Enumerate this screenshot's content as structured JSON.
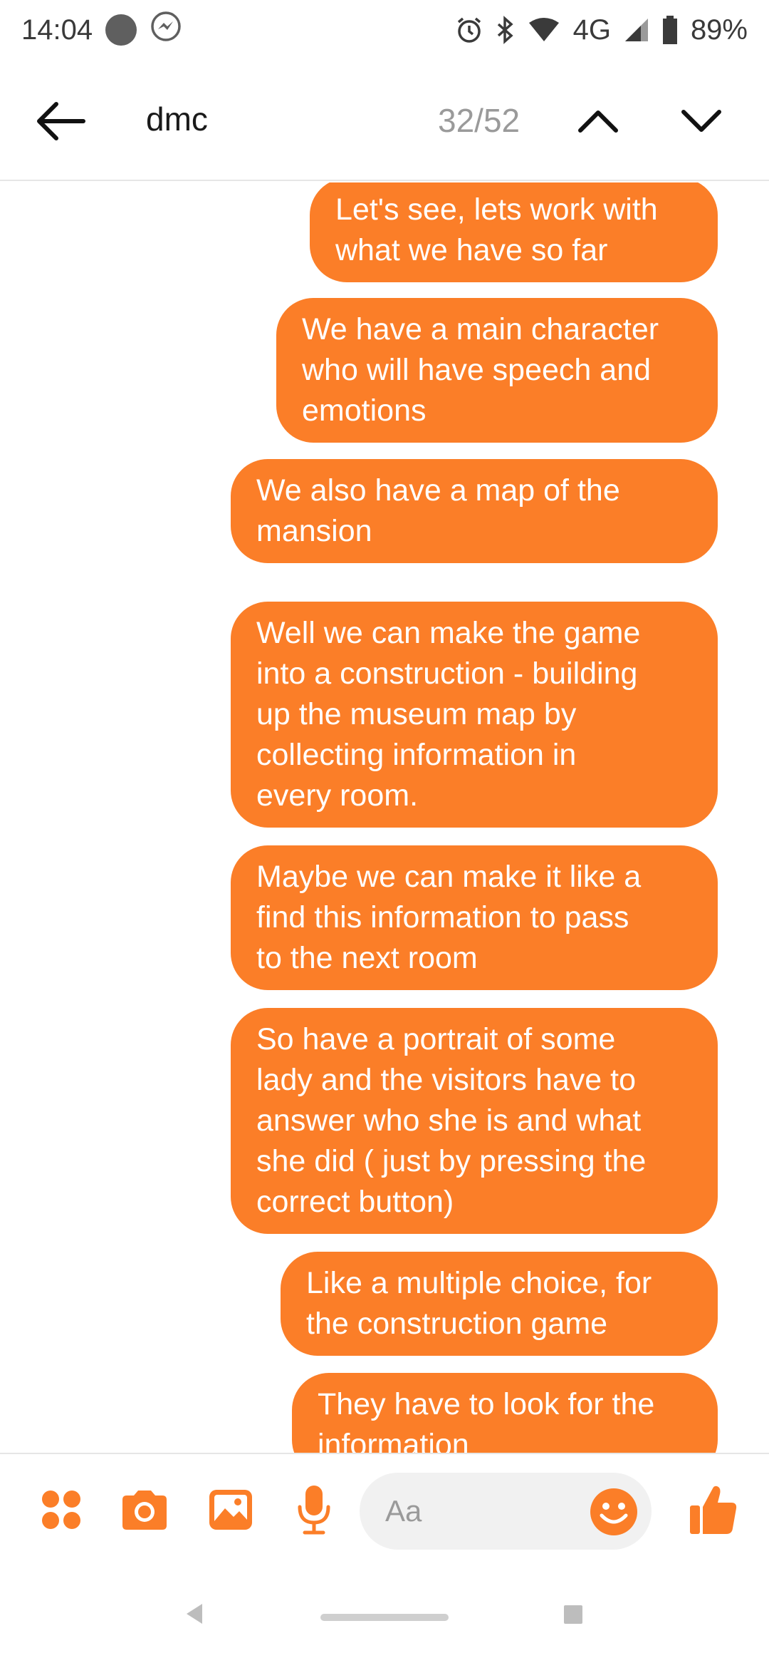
{
  "status_bar": {
    "time": "14:04",
    "network": "4G",
    "battery": "89%",
    "icons": [
      "messenger-icon",
      "alarm-icon",
      "bluetooth-icon",
      "wifi-icon",
      "signal-icon",
      "battery-icon"
    ]
  },
  "header": {
    "search_query": "dmc",
    "match_counter": "32/52"
  },
  "messages": [
    {
      "text": "Let's see, lets work with\nwhat we have so far"
    },
    {
      "text": "We have a main character\nwho will have speech and\nemotions"
    },
    {
      "text": "We also have a map of the\nmansion"
    },
    {
      "text": "Well we can make the game\ninto a construction - building\nup the museum map by\ncollecting information in\nevery room."
    },
    {
      "text": "Maybe we can make it like a\nfind this information to pass\nto the next room"
    },
    {
      "text": "So have a portrait of some\nlady and the visitors have to\nanswer who she is and what\nshe did ( just by pressing the\ncorrect button)"
    },
    {
      "text": "Like a multiple choice, for\nthe construction game"
    },
    {
      "text": "They have to look for the\ninformation"
    }
  ],
  "composer": {
    "placeholder": "Aa"
  },
  "colors": {
    "accent": "#fb7e28",
    "bubble_text": "#ffffff",
    "divider": "#e6e6e6",
    "input_bg": "#f1f1f1"
  }
}
